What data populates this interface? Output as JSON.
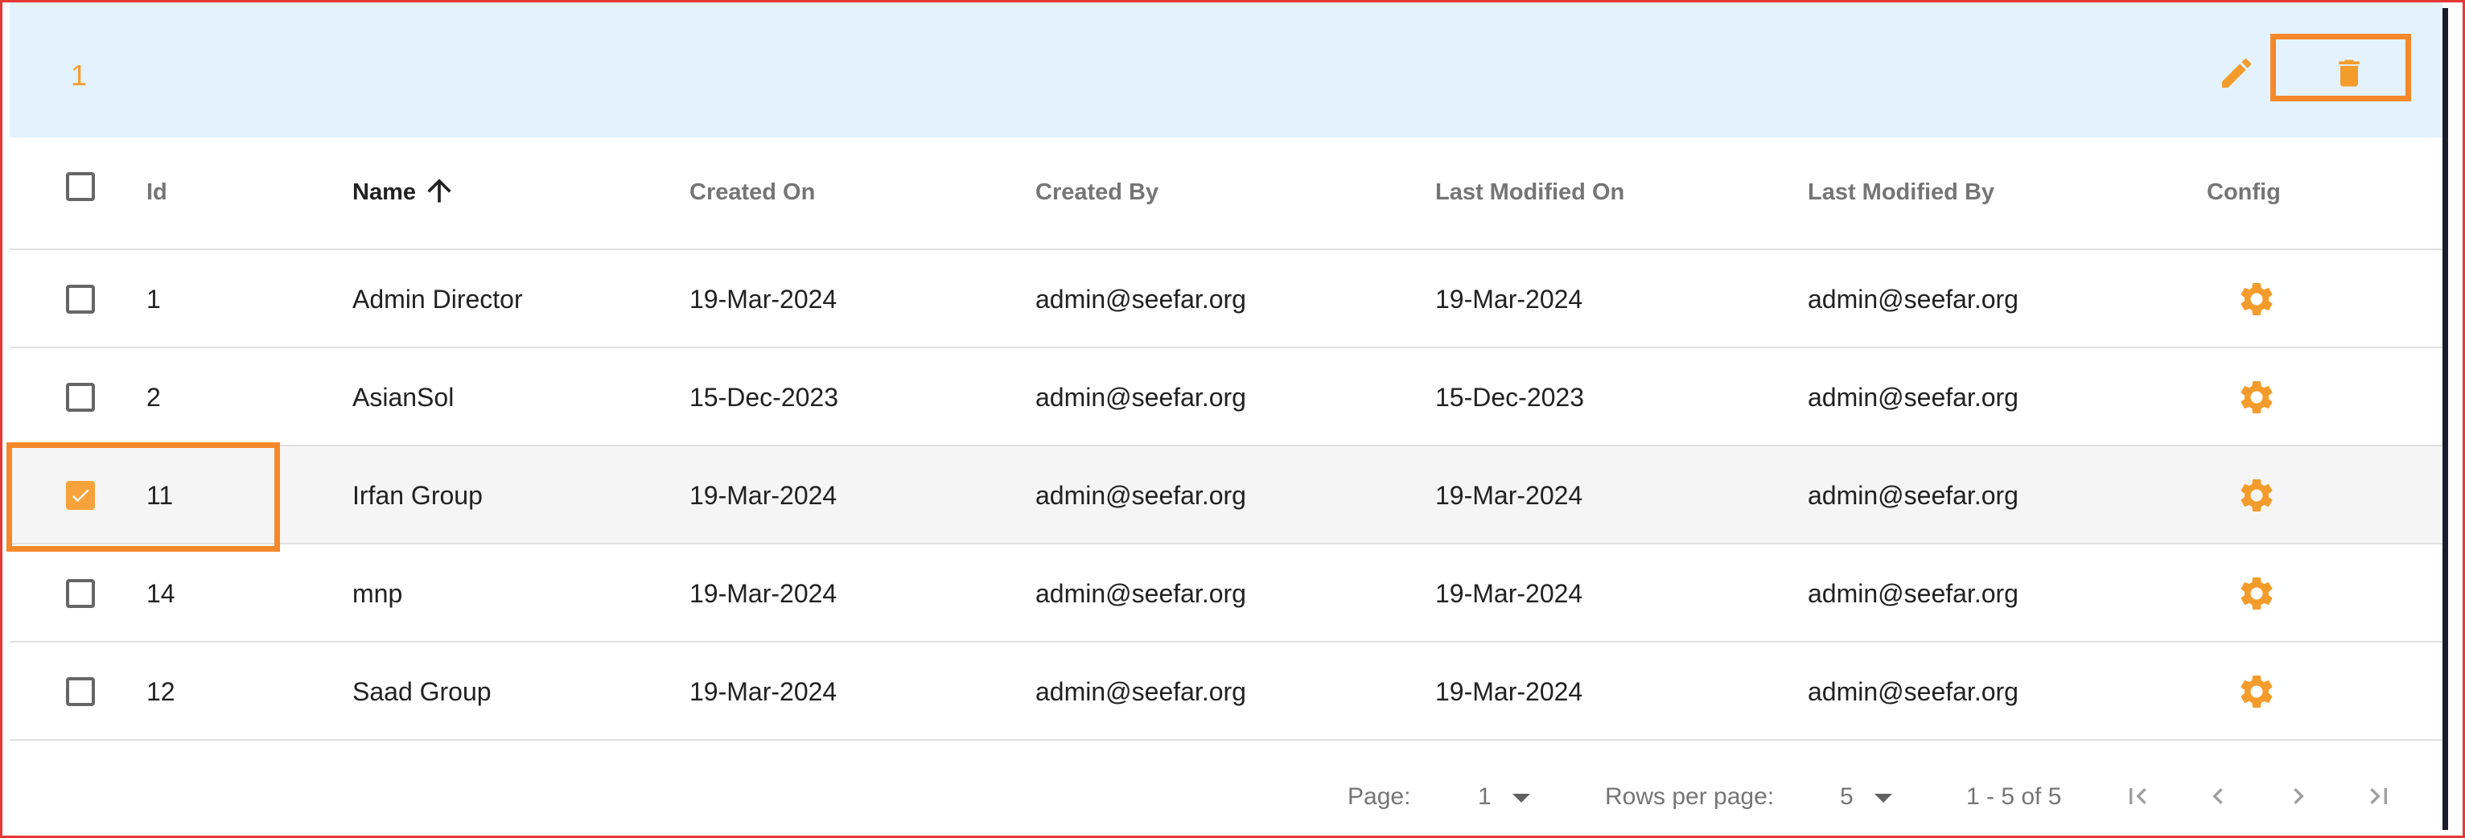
{
  "toolbar": {
    "selected_count": "1",
    "edit_icon": "pencil-icon",
    "delete_icon": "trash-icon",
    "accent_color": "#f39c2c",
    "background_color": "#e3f2fd"
  },
  "columns": {
    "id": "Id",
    "name": "Name",
    "created_on": "Created On",
    "created_by": "Created By",
    "last_modified_on": "Last Modified On",
    "last_modified_by": "Last Modified By",
    "config": "Config",
    "sort_icon": "arrow-up-icon"
  },
  "rows": [
    {
      "id": "1",
      "name": "Admin Director",
      "created_on": "19-Mar-2024",
      "created_by": "admin@seefar.org",
      "last_modified_on": "19-Mar-2024",
      "last_modified_by": "admin@seefar.org",
      "checked": false
    },
    {
      "id": "2",
      "name": "AsianSol",
      "created_on": "15-Dec-2023",
      "created_by": "admin@seefar.org",
      "last_modified_on": "15-Dec-2023",
      "last_modified_by": "admin@seefar.org",
      "checked": false
    },
    {
      "id": "11",
      "name": "Irfan Group",
      "created_on": "19-Mar-2024",
      "created_by": "admin@seefar.org",
      "last_modified_on": "19-Mar-2024",
      "last_modified_by": "admin@seefar.org",
      "checked": true
    },
    {
      "id": "14",
      "name": "mnp",
      "created_on": "19-Mar-2024",
      "created_by": "admin@seefar.org",
      "last_modified_on": "19-Mar-2024",
      "last_modified_by": "admin@seefar.org",
      "checked": false
    },
    {
      "id": "12",
      "name": "Saad Group",
      "created_on": "19-Mar-2024",
      "created_by": "admin@seefar.org",
      "last_modified_on": "19-Mar-2024",
      "last_modified_by": "admin@seefar.org",
      "checked": false
    }
  ],
  "footer": {
    "page_label": "Page:",
    "page_value": "1",
    "rows_per_page_label": "Rows per page:",
    "rows_per_page_value": "5",
    "range": "1 - 5 of 5"
  }
}
